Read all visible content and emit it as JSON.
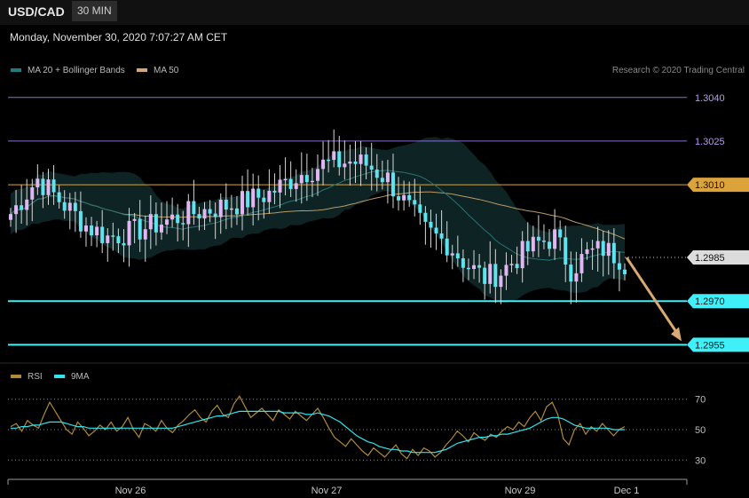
{
  "header": {
    "pair": "USD/CAD",
    "timeframe": "30 MIN",
    "datetime": "Monday, November 30, 2020 7:07:27 AM CET"
  },
  "legend_main": [
    {
      "label": "MA 20 + Bollinger Bands",
      "color": "#1f7d7d"
    },
    {
      "label": "MA 50",
      "color": "#d2a872"
    }
  ],
  "legend_rsi": [
    {
      "label": "RSI",
      "color": "#b08a3a"
    },
    {
      "label": "9MA",
      "color": "#2ee6ef"
    }
  ],
  "credit": "Research © 2020 Trading Central",
  "colors": {
    "up": "#e2b6f2",
    "down": "#5fe3ee",
    "cyan": "#3ff0f8",
    "orange": "#dca33a",
    "purple": "#8a6cd8",
    "grey_label": "#dcdcdc"
  },
  "chart_data": [
    {
      "type": "candlestick",
      "ylim": [
        1.29484,
        1.30445
      ],
      "price_levels": [
        {
          "value": 1.304,
          "label": "1.3040",
          "style": "purple-line"
        },
        {
          "value": 1.3025,
          "label": "1.3025",
          "style": "purple-line"
        },
        {
          "value": 1.301,
          "label": "1.3010",
          "style": "orange-tag"
        },
        {
          "value": 1.2985,
          "label": "1.2985",
          "style": "dotted-current"
        },
        {
          "value": 1.297,
          "label": "1.2970",
          "style": "cyan-tag"
        },
        {
          "value": 1.2955,
          "label": "1.2955",
          "style": "cyan-tag"
        }
      ],
      "forecast_arrow": {
        "from": 1.2985,
        "to": 1.2955
      },
      "x_ticks": [
        "Nov 26",
        "Nov 27",
        "Nov 29",
        "Dec 1"
      ]
    },
    {
      "type": "line",
      "title": "RSI",
      "ylim": [
        22,
        78
      ],
      "levels": [
        70,
        50,
        30
      ],
      "series": [
        {
          "name": "RSI",
          "values": [
            52,
            54,
            49,
            56,
            53,
            51,
            60,
            68,
            62,
            56,
            50,
            47,
            55,
            51,
            46,
            49,
            53,
            50,
            55,
            49,
            52,
            58,
            50,
            45,
            54,
            52,
            49,
            56,
            51,
            48,
            53,
            56,
            60,
            63,
            58,
            55,
            62,
            66,
            60,
            58,
            67,
            72,
            65,
            58,
            61,
            64,
            60,
            56,
            63,
            60,
            57,
            62,
            59,
            56,
            60,
            64,
            58,
            51,
            45,
            42,
            39,
            44,
            40,
            36,
            33,
            38,
            35,
            32,
            36,
            40,
            34,
            31,
            37,
            33,
            38,
            36,
            32,
            35,
            40,
            44,
            49,
            46,
            42,
            48,
            45,
            43,
            47,
            45,
            49,
            52,
            50,
            55,
            52,
            58,
            62,
            56,
            65,
            68,
            60,
            44,
            40,
            50,
            54,
            47,
            52,
            49,
            54,
            50,
            46,
            50,
            52
          ]
        },
        {
          "name": "9MA",
          "values": [
            51,
            51,
            52,
            52,
            53,
            53,
            54,
            55,
            55,
            55,
            54,
            53,
            52,
            52,
            51,
            51,
            51,
            51,
            51,
            51,
            51,
            51,
            51,
            51,
            51,
            51,
            51,
            51,
            51,
            51,
            52,
            53,
            54,
            55,
            56,
            57,
            58,
            59,
            59,
            60,
            61,
            62,
            62,
            62,
            62,
            62,
            62,
            62,
            62,
            61,
            61,
            61,
            61,
            60,
            60,
            61,
            60,
            59,
            57,
            55,
            52,
            49,
            46,
            44,
            42,
            41,
            39,
            38,
            37,
            37,
            36,
            36,
            35,
            35,
            35,
            35,
            35,
            36,
            37,
            39,
            41,
            42,
            43,
            44,
            45,
            45,
            46,
            46,
            47,
            47,
            48,
            49,
            50,
            51,
            53,
            55,
            57,
            58,
            58,
            57,
            55,
            53,
            52,
            51,
            51,
            51,
            51,
            51,
            50,
            50,
            50
          ]
        }
      ]
    }
  ]
}
